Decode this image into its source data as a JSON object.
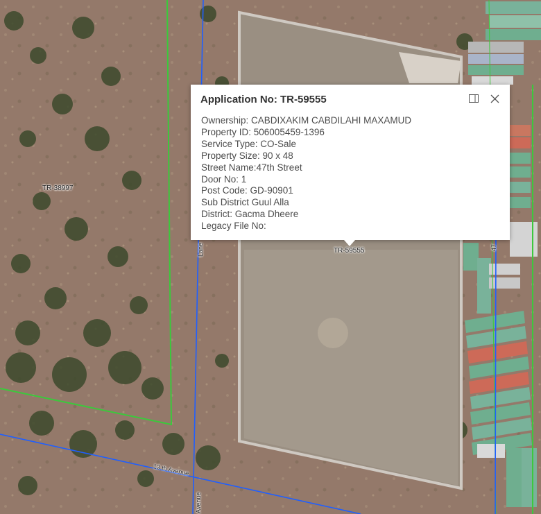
{
  "popup": {
    "title": "Application No: TR-59555",
    "dock_icon": "dock-icon",
    "close_icon": "close-icon",
    "fields": [
      "Ownership: CABDIXAKIM CABDILAHI MAXAMUD",
      "Property ID: 506005459-1396",
      "Service Type: CO-Sale",
      "Property Size: 90 x 48",
      "Street Name:47th Street",
      "Door No: 1",
      "Post Code: GD-90901",
      "Sub District Guul Alla",
      "District: Gacma Dheere",
      "Legacy File No:"
    ]
  },
  "map": {
    "parcel_labels": {
      "left": "TR-38997",
      "center": "TR-59555"
    },
    "road_labels": {
      "lane": "Lane",
      "avenue_13": "13 th Avenue",
      "avenue_vertical": "Avenue",
      "street_47": "47"
    },
    "colors": {
      "parcel_outline": "#3cc83c",
      "road_line": "#1f5fff"
    }
  }
}
